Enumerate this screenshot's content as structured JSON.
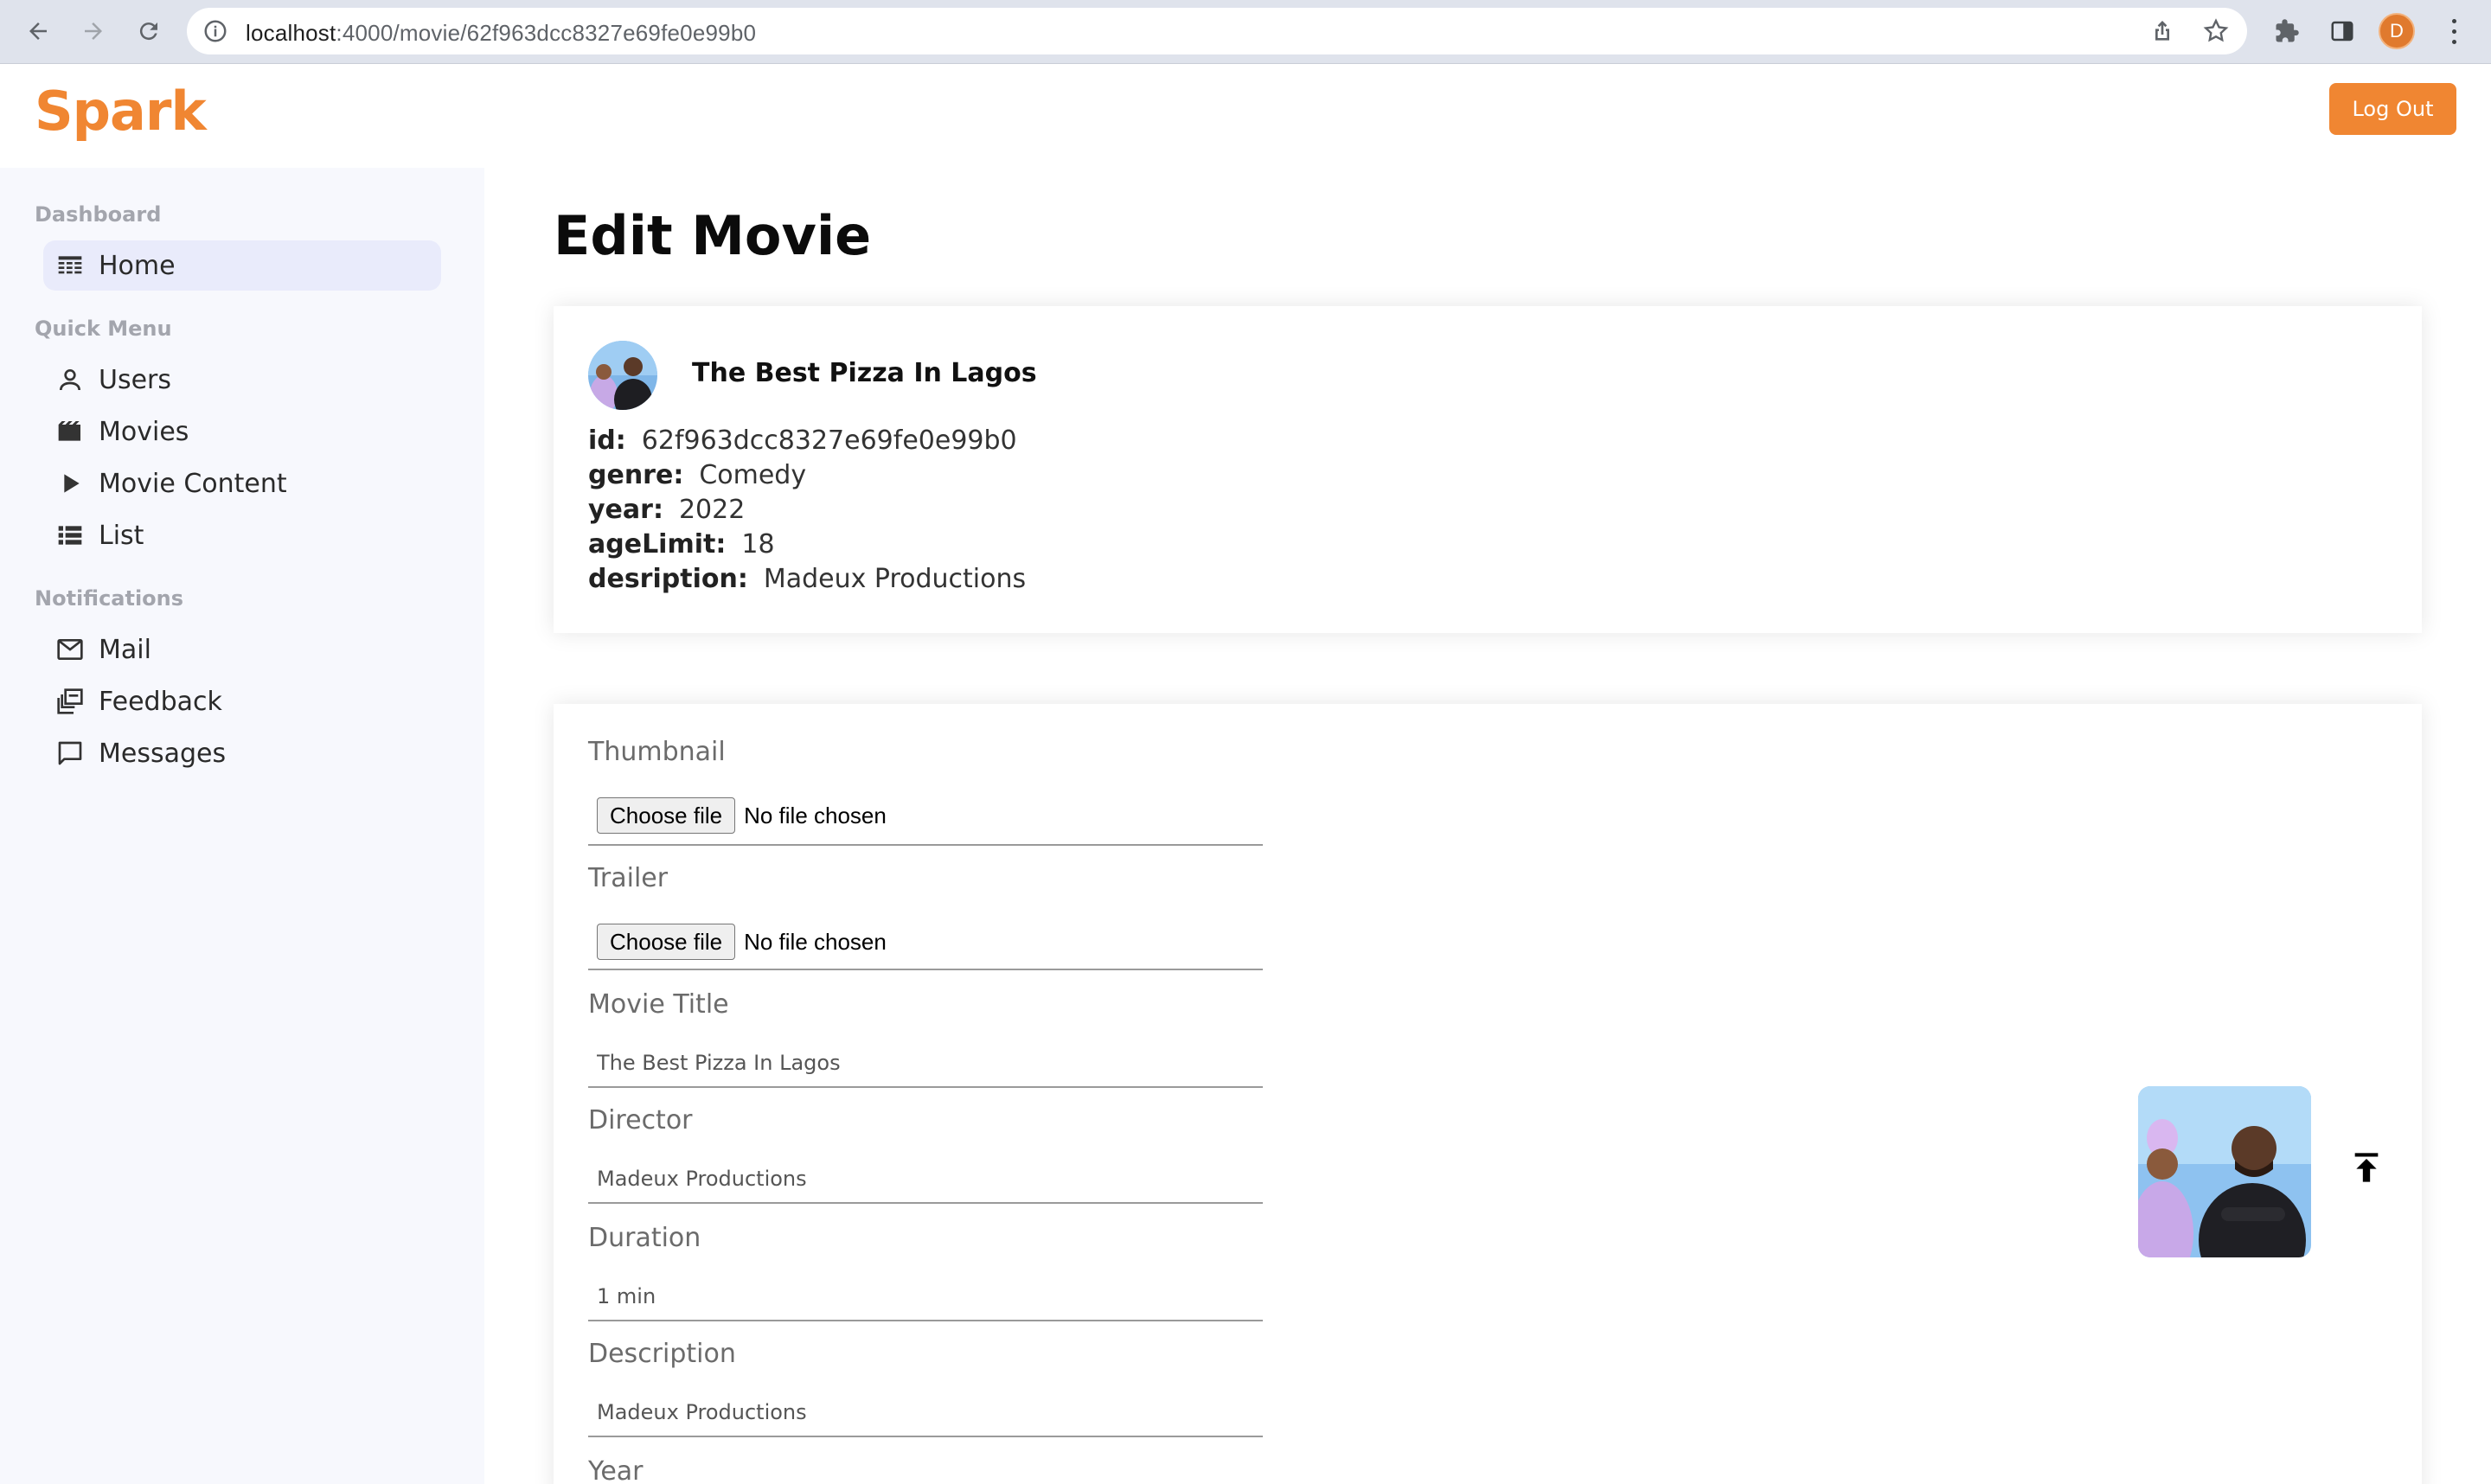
{
  "browser": {
    "url_host": "localhost",
    "url_path": ":4000/movie/62f963dcc8327e69fe0e99b0",
    "profile_initial": "D"
  },
  "app": {
    "logo": "Spark",
    "logout_label": "Log Out"
  },
  "sidebar": {
    "sections": [
      {
        "title": "Dashboard",
        "items": [
          {
            "label": "Home",
            "icon": "dashboard-icon",
            "active": true
          }
        ]
      },
      {
        "title": "Quick Menu",
        "items": [
          {
            "label": "Users",
            "icon": "user-icon"
          },
          {
            "label": "Movies",
            "icon": "movie-clapper-icon"
          },
          {
            "label": "Movie Content",
            "icon": "play-icon"
          },
          {
            "label": "List",
            "icon": "list-icon"
          }
        ]
      },
      {
        "title": "Notifications",
        "items": [
          {
            "label": "Mail",
            "icon": "mail-icon"
          },
          {
            "label": "Feedback",
            "icon": "feedback-icon"
          },
          {
            "label": "Messages",
            "icon": "chat-icon"
          }
        ]
      }
    ]
  },
  "page": {
    "title": "Edit Movie"
  },
  "movie": {
    "name": "The Best Pizza In Lagos",
    "fields": [
      {
        "key": "id:",
        "value": "62f963dcc8327e69fe0e99b0"
      },
      {
        "key": "genre:",
        "value": "Comedy"
      },
      {
        "key": "year:",
        "value": "2022"
      },
      {
        "key": "ageLimit:",
        "value": "18"
      },
      {
        "key": "desription:",
        "value": "Madeux Productions"
      }
    ]
  },
  "form": {
    "thumbnail_label": "Thumbnail",
    "trailer_label": "Trailer",
    "choose_file_label": "Choose file",
    "no_file_text": "No file chosen",
    "title_label": "Movie Title",
    "title_placeholder": "The Best Pizza In Lagos",
    "director_label": "Director",
    "director_placeholder": "Madeux Productions",
    "duration_label": "Duration",
    "duration_placeholder": "1 min",
    "description_label": "Description",
    "description_placeholder": "Madeux Productions",
    "year_label": "Year"
  },
  "colors": {
    "accent": "#f08632",
    "sidebar_bg": "#f7f8fd",
    "active_item_bg": "#e9ebfb"
  }
}
